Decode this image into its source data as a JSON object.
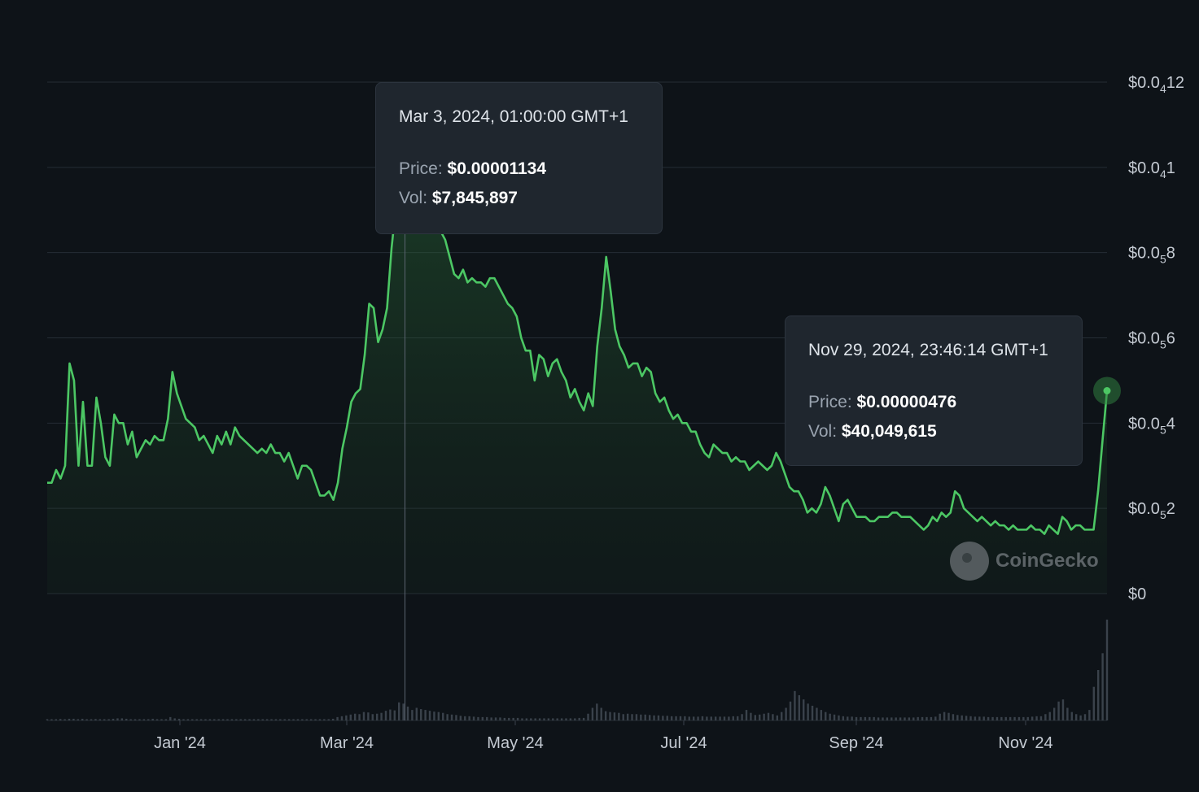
{
  "chart_data": {
    "type": "area",
    "title": "",
    "xlabel": "",
    "ylabel": "",
    "x_ticks": [
      "Jan '24",
      "Mar '24",
      "May '24",
      "Jul '24",
      "Sep '24",
      "Nov '24"
    ],
    "y_ticks": [
      {
        "value": 0,
        "main": "$0",
        "sub": "",
        "tail": ""
      },
      {
        "value": 2e-06,
        "main": "$0.0",
        "sub": "5",
        "tail": "2"
      },
      {
        "value": 4e-06,
        "main": "$0.0",
        "sub": "5",
        "tail": "4"
      },
      {
        "value": 6e-06,
        "main": "$0.0",
        "sub": "5",
        "tail": "6"
      },
      {
        "value": 8e-06,
        "main": "$0.0",
        "sub": "5",
        "tail": "8"
      },
      {
        "value": 1e-05,
        "main": "$0.0",
        "sub": "4",
        "tail": "1"
      },
      {
        "value": 1.2e-05,
        "main": "$0.0",
        "sub": "4",
        "tail": "12"
      }
    ],
    "ylim": [
      0,
      1.2e-05
    ],
    "grid": true,
    "line_color": "#4cc764",
    "background": "#0e1318",
    "series": [
      {
        "values": [
          2.6e-06,
          2.6e-06,
          2.9e-06,
          2.7e-06,
          3e-06,
          5.4e-06,
          5e-06,
          3e-06,
          4.5e-06,
          3e-06,
          3e-06,
          4.6e-06,
          4e-06,
          3.2e-06,
          3e-06,
          4.2e-06,
          4e-06,
          4e-06,
          3.5e-06,
          3.8e-06,
          3.2e-06,
          3.4e-06,
          3.6e-06,
          3.5e-06,
          3.7e-06,
          3.6e-06,
          3.6e-06,
          4.1e-06,
          5.2e-06,
          4.7e-06,
          4.4e-06,
          4.1e-06,
          4e-06,
          3.9e-06,
          3.6e-06,
          3.7e-06,
          3.5e-06,
          3.3e-06,
          3.7e-06,
          3.5e-06,
          3.8e-06,
          3.5e-06,
          3.9e-06,
          3.7e-06,
          3.6e-06,
          3.5e-06,
          3.4e-06,
          3.3e-06,
          3.4e-06,
          3.3e-06,
          3.5e-06,
          3.3e-06,
          3.3e-06,
          3.1e-06,
          3.3e-06,
          3e-06,
          2.7e-06,
          3e-06,
          3e-06,
          2.9e-06,
          2.6e-06,
          2.3e-06,
          2.3e-06,
          2.4e-06,
          2.2e-06,
          2.6e-06,
          3.4e-06,
          3.9e-06,
          4.5e-06,
          4.7e-06,
          4.8e-06,
          5.6e-06,
          6.8e-06,
          6.7e-06,
          5.9e-06,
          6.2e-06,
          6.7e-06,
          8.1e-06,
          9.1e-06,
          9.2e-06,
          1.13e-05,
          1.08e-05,
          1.05e-05,
          9e-06,
          1.02e-05,
          9.8e-06,
          9.5e-06,
          8.9e-06,
          8.5e-06,
          8.3e-06,
          7.9e-06,
          7.5e-06,
          7.4e-06,
          7.6e-06,
          7.3e-06,
          7.4e-06,
          7.3e-06,
          7.3e-06,
          7.2e-06,
          7.4e-06,
          7.4e-06,
          7.2e-06,
          7e-06,
          6.8e-06,
          6.7e-06,
          6.5e-06,
          6e-06,
          5.7e-06,
          5.7e-06,
          5e-06,
          5.6e-06,
          5.5e-06,
          5.1e-06,
          5.4e-06,
          5.5e-06,
          5.2e-06,
          5e-06,
          4.6e-06,
          4.8e-06,
          4.5e-06,
          4.3e-06,
          4.7e-06,
          4.4e-06,
          5.8e-06,
          6.7e-06,
          7.9e-06,
          7.1e-06,
          6.2e-06,
          5.8e-06,
          5.6e-06,
          5.3e-06,
          5.4e-06,
          5.4e-06,
          5.1e-06,
          5.3e-06,
          5.2e-06,
          4.7e-06,
          4.5e-06,
          4.6e-06,
          4.3e-06,
          4.1e-06,
          4.2e-06,
          4e-06,
          4e-06,
          3.8e-06,
          3.8e-06,
          3.5e-06,
          3.3e-06,
          3.2e-06,
          3.5e-06,
          3.4e-06,
          3.3e-06,
          3.3e-06,
          3.1e-06,
          3.2e-06,
          3.1e-06,
          3.1e-06,
          2.9e-06,
          3e-06,
          3.1e-06,
          3e-06,
          2.9e-06,
          3e-06,
          3.3e-06,
          3.1e-06,
          2.8e-06,
          2.5e-06,
          2.4e-06,
          2.4e-06,
          2.2e-06,
          1.9e-06,
          2e-06,
          1.9e-06,
          2.1e-06,
          2.5e-06,
          2.3e-06,
          2e-06,
          1.7e-06,
          2.1e-06,
          2.2e-06,
          2e-06,
          1.8e-06,
          1.8e-06,
          1.8e-06,
          1.7e-06,
          1.7e-06,
          1.8e-06,
          1.8e-06,
          1.8e-06,
          1.9e-06,
          1.9e-06,
          1.8e-06,
          1.8e-06,
          1.8e-06,
          1.7e-06,
          1.6e-06,
          1.5e-06,
          1.6e-06,
          1.8e-06,
          1.7e-06,
          1.9e-06,
          1.8e-06,
          1.9e-06,
          2.4e-06,
          2.3e-06,
          2e-06,
          1.9e-06,
          1.8e-06,
          1.7e-06,
          1.8e-06,
          1.7e-06,
          1.6e-06,
          1.7e-06,
          1.6e-06,
          1.6e-06,
          1.5e-06,
          1.6e-06,
          1.5e-06,
          1.5e-06,
          1.5e-06,
          1.6e-06,
          1.5e-06,
          1.5e-06,
          1.4e-06,
          1.6e-06,
          1.5e-06,
          1.4e-06,
          1.8e-06,
          1.7e-06,
          1.5e-06,
          1.6e-06,
          1.6e-06,
          1.5e-06,
          1.5e-06,
          1.5e-06,
          2.4e-06,
          3.6e-06,
          4.76e-06
        ]
      }
    ],
    "volume": [
      0.3,
      0.3,
      0.3,
      0.35,
      0.3,
      0.4,
      0.4,
      0.3,
      0.4,
      0.3,
      0.3,
      0.35,
      0.3,
      0.3,
      0.3,
      0.4,
      0.5,
      0.5,
      0.4,
      0.3,
      0.3,
      0.3,
      0.3,
      0.3,
      0.4,
      0.3,
      0.3,
      0.3,
      0.8,
      0.5,
      0.4,
      0.3,
      0.3,
      0.3,
      0.3,
      0.3,
      0.3,
      0.3,
      0.3,
      0.3,
      0.3,
      0.3,
      0.3,
      0.3,
      0.3,
      0.3,
      0.3,
      0.3,
      0.3,
      0.3,
      0.3,
      0.3,
      0.3,
      0.3,
      0.3,
      0.3,
      0.3,
      0.3,
      0.3,
      0.3,
      0.3,
      0.3,
      0.3,
      0.3,
      0.3,
      0.4,
      0.8,
      1.0,
      1.2,
      1.4,
      1.6,
      1.5,
      2.0,
      1.9,
      1.5,
      1.6,
      1.8,
      2.3,
      2.6,
      2.4,
      4.3,
      4.0,
      3.3,
      2.5,
      3.0,
      2.7,
      2.5,
      2.3,
      2.1,
      2.0,
      1.8,
      1.5,
      1.4,
      1.3,
      1.1,
      1.0,
      1.0,
      0.9,
      0.8,
      0.8,
      0.8,
      0.7,
      0.7,
      0.7,
      0.6,
      0.6,
      0.6,
      0.6,
      0.5,
      0.5,
      0.5,
      0.5,
      0.5,
      0.5,
      0.5,
      0.5,
      0.5,
      0.5,
      0.5,
      0.5,
      0.5,
      0.6,
      0.6,
      1.6,
      3.0,
      4.0,
      3.0,
      2.2,
      2.0,
      1.9,
      1.8,
      1.5,
      1.6,
      1.5,
      1.5,
      1.4,
      1.4,
      1.3,
      1.2,
      1.2,
      1.1,
      1.1,
      1.0,
      1.0,
      1.0,
      1.0,
      0.9,
      0.9,
      0.9,
      1.0,
      0.9,
      0.9,
      0.9,
      0.9,
      0.9,
      0.9,
      1.0,
      1.0,
      1.5,
      2.5,
      1.8,
      1.3,
      1.4,
      1.6,
      1.8,
      1.5,
      1.2,
      2.0,
      3.0,
      4.5,
      7.0,
      6.0,
      5.0,
      4.0,
      3.5,
      3.0,
      2.5,
      2.0,
      1.6,
      1.4,
      1.2,
      1.0,
      0.9,
      0.9,
      0.8,
      0.8,
      0.8,
      0.8,
      0.8,
      0.7,
      0.7,
      0.7,
      0.7,
      0.7,
      0.7,
      0.7,
      0.7,
      0.7,
      0.8,
      0.8,
      0.8,
      0.8,
      0.9,
      1.6,
      2.0,
      1.8,
      1.5,
      1.3,
      1.2,
      1.1,
      1.0,
      0.9,
      0.9,
      0.9,
      0.8,
      0.8,
      0.8,
      0.8,
      0.8,
      0.8,
      0.8,
      0.8,
      0.8,
      0.8,
      0.9,
      1.0,
      1.0,
      1.5,
      2.0,
      3.0,
      4.5,
      5.0,
      3.0,
      2.0,
      1.5,
      1.2,
      1.5,
      2.5,
      8.0,
      12.0,
      16.0,
      24.0
    ]
  },
  "tooltips": {
    "peak": {
      "date": "Mar 3, 2024, 01:00:00 GMT+1",
      "price_label": "Price:",
      "price_value": "$0.00001134",
      "vol_label": "Vol:",
      "vol_value": "$7,845,897"
    },
    "latest": {
      "date": "Nov 29, 2024, 23:46:14 GMT+1",
      "price_label": "Price:",
      "price_value": "$0.00000476",
      "vol_label": "Vol:",
      "vol_value": "$40,049,615"
    }
  },
  "watermark": {
    "text": "CoinGecko",
    "icon": "coingecko-logo-icon"
  }
}
